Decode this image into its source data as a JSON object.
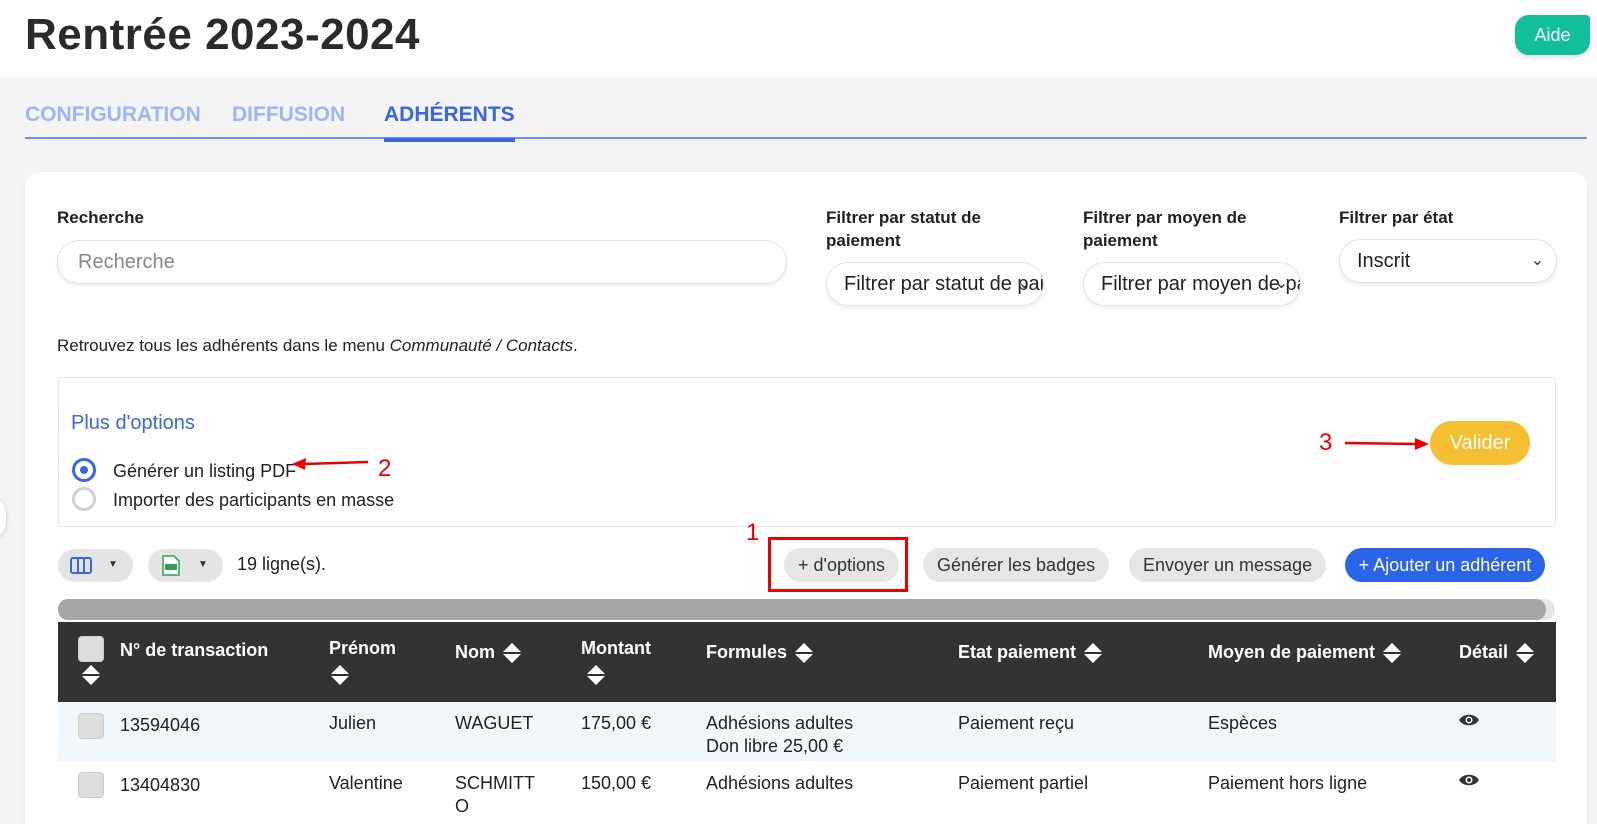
{
  "header": {
    "title": "Rentrée 2023-2024",
    "help_label": "Aide"
  },
  "tabs": [
    {
      "label": "CONFIGURATION",
      "active": false
    },
    {
      "label": "DIFFUSION",
      "active": false
    },
    {
      "label": "ADHÉRENTS",
      "active": true
    }
  ],
  "filters": {
    "search_label": "Recherche",
    "search_placeholder": "Recherche",
    "payment_status_label": "Filtrer par statut de paiement",
    "payment_status_value": "Filtrer par statut de paiement",
    "payment_method_label": "Filtrer par moyen de paiement",
    "payment_method_value": "Filtrer par moyen de paiement",
    "state_label": "Filtrer par état",
    "state_value": "Inscrit"
  },
  "info": {
    "prefix": "Retrouvez tous les adhérents dans le menu ",
    "link": "Communauté / Contacts",
    "suffix": "."
  },
  "more_options": {
    "title": "Plus d'options",
    "options": [
      {
        "label": "Générer un listing PDF",
        "checked": true
      },
      {
        "label": "Importer des participants en masse",
        "checked": false
      }
    ],
    "validate_label": "Valider"
  },
  "annotations": {
    "one": "1",
    "two": "2",
    "three": "3"
  },
  "toolbar": {
    "rows_count": "19 ligne(s).",
    "more_options_label": "+ d'options",
    "badges_label": "Générer les badges",
    "message_label": "Envoyer un message",
    "add_member_label": "+ Ajouter un adhérent"
  },
  "table": {
    "columns": [
      "N° de transaction",
      "Prénom",
      "Nom",
      "Montant",
      "Formules",
      "Etat paiement",
      "Moyen de paiement",
      "Détail"
    ],
    "rows": [
      {
        "transaction": "13594046",
        "first_name": "Julien",
        "last_name": "WAGUET",
        "amount": "175,00 €",
        "formula_1": "Adhésions adultes",
        "formula_2": "Don libre 25,00 €",
        "payment_state": "Paiement reçu",
        "payment_method": "Espèces"
      },
      {
        "transaction": "13404830",
        "first_name": "Valentine",
        "last_name_1": "SCHMITT",
        "last_name_2": "O",
        "amount": "150,00 €",
        "formula_1": "Adhésions adultes",
        "payment_state": "Paiement partiel",
        "payment_method": "Paiement hors ligne"
      }
    ]
  },
  "colors": {
    "accent": "#3a67e0",
    "help": "#11bf9b",
    "validate": "#f4bf31",
    "annotation": "#e00000",
    "table_header": "#333333"
  }
}
